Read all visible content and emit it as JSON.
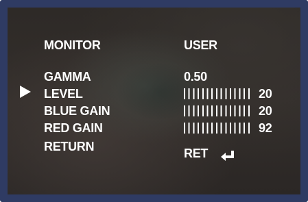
{
  "header": {
    "title": "MONITOR",
    "mode": "USER"
  },
  "menu": {
    "selected_index": 1,
    "items": [
      {
        "label": "GAMMA",
        "value": "0.50"
      },
      {
        "label": "LEVEL",
        "value": "20"
      },
      {
        "label": "BLUE GAIN",
        "value": "20"
      },
      {
        "label": "RED GAIN",
        "value": "92"
      },
      {
        "label": "RETURN",
        "value": "RET"
      }
    ]
  },
  "icons": {
    "cursor": "right-triangle-icon",
    "return": "enter-arrow-icon"
  },
  "colors": {
    "bezel": "#2f3b63",
    "text": "#ffffff"
  }
}
